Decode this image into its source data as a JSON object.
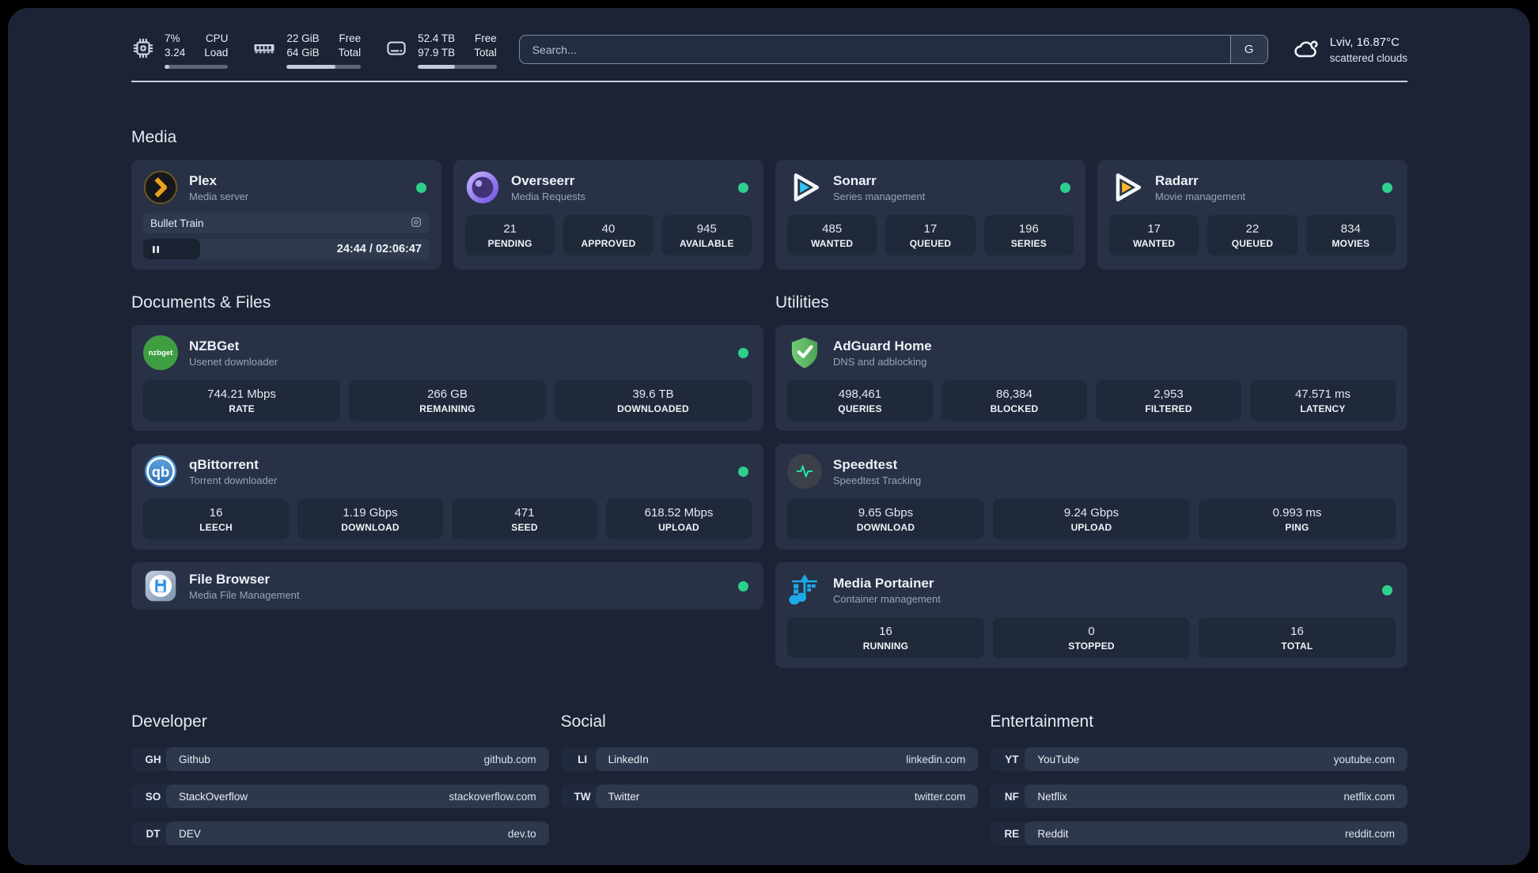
{
  "header": {
    "cpu": {
      "value_top": "7%",
      "value_bottom": "3.24",
      "label_top": "CPU",
      "label_bottom": "Load",
      "progress": 7
    },
    "memory": {
      "value_top": "22 GiB",
      "value_bottom": "64 GiB",
      "label_top": "Free",
      "label_bottom": "Total",
      "progress": 66
    },
    "disk": {
      "value_top": "52.4 TB",
      "value_bottom": "97.9 TB",
      "label_top": "Free",
      "label_bottom": "Total",
      "progress": 47
    },
    "search": {
      "placeholder": "Search...",
      "provider_label": "G"
    },
    "weather": {
      "title": "Lviv, 16.87°C",
      "condition": "scattered clouds"
    }
  },
  "colors": {
    "status_online": "#2dd08b"
  },
  "sections": {
    "media": {
      "title": "Media",
      "cards": [
        {
          "name": "Plex",
          "subtitle": "Media server",
          "now_playing": "Bullet Train",
          "time": "24:44 / 02:06:47",
          "progress": 20
        },
        {
          "name": "Overseerr",
          "subtitle": "Media Requests",
          "stats": [
            {
              "value": "21",
              "label": "PENDING"
            },
            {
              "value": "40",
              "label": "APPROVED"
            },
            {
              "value": "945",
              "label": "AVAILABLE"
            }
          ]
        },
        {
          "name": "Sonarr",
          "subtitle": "Series management",
          "stats": [
            {
              "value": "485",
              "label": "WANTED"
            },
            {
              "value": "17",
              "label": "QUEUED"
            },
            {
              "value": "196",
              "label": "SERIES"
            }
          ]
        },
        {
          "name": "Radarr",
          "subtitle": "Movie management",
          "stats": [
            {
              "value": "17",
              "label": "WANTED"
            },
            {
              "value": "22",
              "label": "QUEUED"
            },
            {
              "value": "834",
              "label": "MOVIES"
            }
          ]
        }
      ]
    },
    "documents": {
      "title": "Documents & Files",
      "cards": [
        {
          "name": "NZBGet",
          "subtitle": "Usenet downloader",
          "stats": [
            {
              "value": "744.21 Mbps",
              "label": "RATE"
            },
            {
              "value": "266 GB",
              "label": "REMAINING"
            },
            {
              "value": "39.6 TB",
              "label": "DOWNLOADED"
            }
          ]
        },
        {
          "name": "qBittorrent",
          "subtitle": "Torrent downloader",
          "stats": [
            {
              "value": "16",
              "label": "LEECH"
            },
            {
              "value": "1.19 Gbps",
              "label": "DOWNLOAD"
            },
            {
              "value": "471",
              "label": "SEED"
            },
            {
              "value": "618.52 Mbps",
              "label": "UPLOAD"
            }
          ]
        },
        {
          "name": "File Browser",
          "subtitle": "Media File Management",
          "stats": []
        }
      ]
    },
    "utilities": {
      "title": "Utilities",
      "cards": [
        {
          "name": "AdGuard Home",
          "subtitle": "DNS and adblocking",
          "stats": [
            {
              "value": "498,461",
              "label": "QUERIES"
            },
            {
              "value": "86,384",
              "label": "BLOCKED"
            },
            {
              "value": "2,953",
              "label": "FILTERED"
            },
            {
              "value": "47.571 ms",
              "label": "LATENCY"
            }
          ]
        },
        {
          "name": "Speedtest",
          "subtitle": "Speedtest Tracking",
          "stats": [
            {
              "value": "9.65 Gbps",
              "label": "DOWNLOAD"
            },
            {
              "value": "9.24 Gbps",
              "label": "UPLOAD"
            },
            {
              "value": "0.993 ms",
              "label": "PING"
            }
          ]
        },
        {
          "name": "Media Portainer",
          "subtitle": "Container management",
          "stats": [
            {
              "value": "16",
              "label": "RUNNING"
            },
            {
              "value": "0",
              "label": "STOPPED"
            },
            {
              "value": "16",
              "label": "TOTAL"
            }
          ]
        }
      ]
    },
    "developer": {
      "title": "Developer",
      "links": [
        {
          "abbr": "GH",
          "name": "Github",
          "url": "github.com"
        },
        {
          "abbr": "SO",
          "name": "StackOverflow",
          "url": "stackoverflow.com"
        },
        {
          "abbr": "DT",
          "name": "DEV",
          "url": "dev.to"
        }
      ]
    },
    "social": {
      "title": "Social",
      "links": [
        {
          "abbr": "LI",
          "name": "LinkedIn",
          "url": "linkedin.com"
        },
        {
          "abbr": "TW",
          "name": "Twitter",
          "url": "twitter.com"
        }
      ]
    },
    "entertainment": {
      "title": "Entertainment",
      "links": [
        {
          "abbr": "YT",
          "name": "YouTube",
          "url": "youtube.com"
        },
        {
          "abbr": "NF",
          "name": "Netflix",
          "url": "netflix.com"
        },
        {
          "abbr": "RE",
          "name": "Reddit",
          "url": "reddit.com"
        }
      ]
    }
  }
}
